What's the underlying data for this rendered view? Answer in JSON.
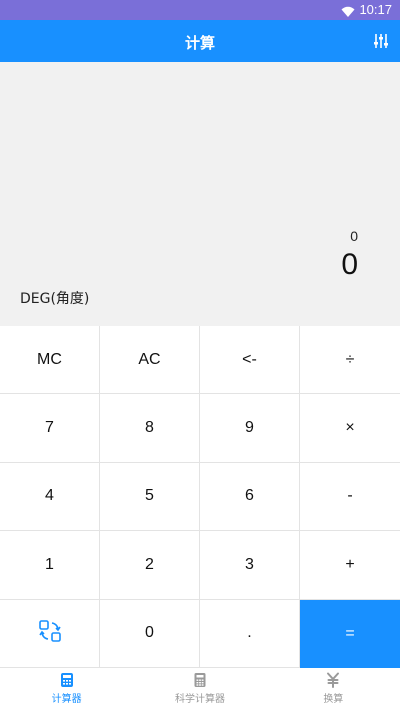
{
  "status_bar": {
    "time": "10:17",
    "wifi_icon": "wifi-icon"
  },
  "app_bar": {
    "title": "计算",
    "settings_icon": "sliders-icon"
  },
  "display": {
    "expression": "0",
    "result": "0",
    "mode": "DEG(角度)"
  },
  "keypad": {
    "rows": [
      [
        "MC",
        "AC",
        "<-",
        "÷"
      ],
      [
        "7",
        "8",
        "9",
        "×"
      ],
      [
        "4",
        "5",
        "6",
        "-"
      ],
      [
        "1",
        "2",
        "3",
        "+"
      ],
      [
        "",
        "0",
        ".",
        "="
      ]
    ],
    "switch_icon": "switch-icon"
  },
  "tabs": [
    {
      "label": "计算器",
      "icon": "calculator-icon",
      "active": true
    },
    {
      "label": "科学计算器",
      "icon": "scientific-calculator-icon",
      "active": false
    },
    {
      "label": "换算",
      "icon": "yuan-icon",
      "active": false
    }
  ],
  "colors": {
    "accent": "#1890ff",
    "status_bar": "#7a6fd8",
    "display_bg": "#f1f1f1",
    "inactive": "#9a9a9a"
  }
}
